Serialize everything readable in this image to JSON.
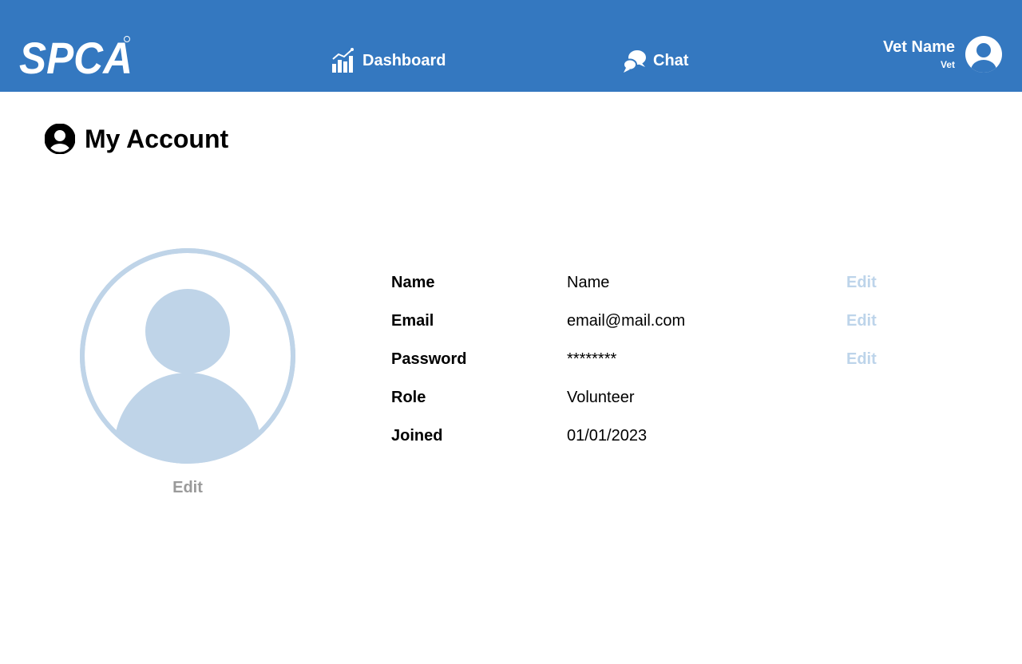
{
  "header": {
    "logo_text": "SPCA",
    "nav": {
      "dashboard_label": "Dashboard",
      "chat_label": "Chat"
    },
    "user": {
      "name": "Vet Name",
      "role": "Vet"
    },
    "background_color": "#3478c0"
  },
  "page": {
    "title": "My Account"
  },
  "profile": {
    "avatar_edit_label": "Edit",
    "avatar_color": "#bfd4e8",
    "fields": [
      {
        "label": "Name",
        "value": "Name",
        "edit": "Edit"
      },
      {
        "label": "Email",
        "value": "email@mail.com",
        "edit": "Edit"
      },
      {
        "label": "Password",
        "value": "********",
        "edit": "Edit"
      },
      {
        "label": "Role",
        "value": "Volunteer"
      },
      {
        "label": "Joined",
        "value": "01/01/2023"
      }
    ]
  }
}
